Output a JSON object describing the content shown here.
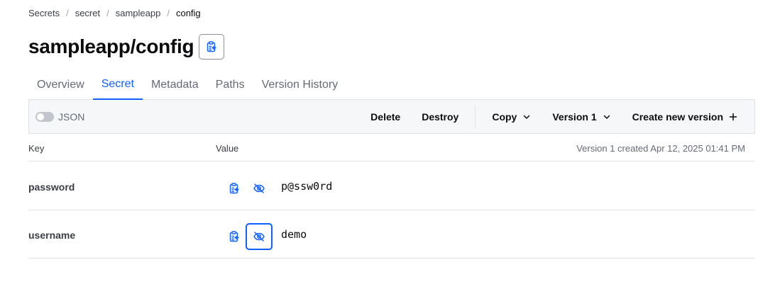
{
  "breadcrumb": [
    "Secrets",
    "secret",
    "sampleapp",
    "config"
  ],
  "title": "sampleapp/config",
  "tabs": [
    {
      "label": "Overview",
      "active": false
    },
    {
      "label": "Secret",
      "active": true
    },
    {
      "label": "Metadata",
      "active": false
    },
    {
      "label": "Paths",
      "active": false
    },
    {
      "label": "Version History",
      "active": false
    }
  ],
  "toolbar": {
    "json_label": "JSON",
    "json_enabled": false,
    "delete_label": "Delete",
    "destroy_label": "Destroy",
    "copy_label": "Copy",
    "version_label": "Version 1",
    "create_label": "Create new version"
  },
  "table": {
    "key_header": "Key",
    "value_header": "Value",
    "version_info": "Version 1 created Apr 12, 2025 01:41 PM",
    "rows": [
      {
        "key": "password",
        "value": "p@ssw0rd"
      },
      {
        "key": "username",
        "value": "demo"
      }
    ]
  },
  "colors": {
    "accent": "#1060ff",
    "text": "#0c0c0e",
    "muted": "#656a76",
    "border": "#dfe1e6",
    "toolbar_bg": "#f6f7f9"
  }
}
